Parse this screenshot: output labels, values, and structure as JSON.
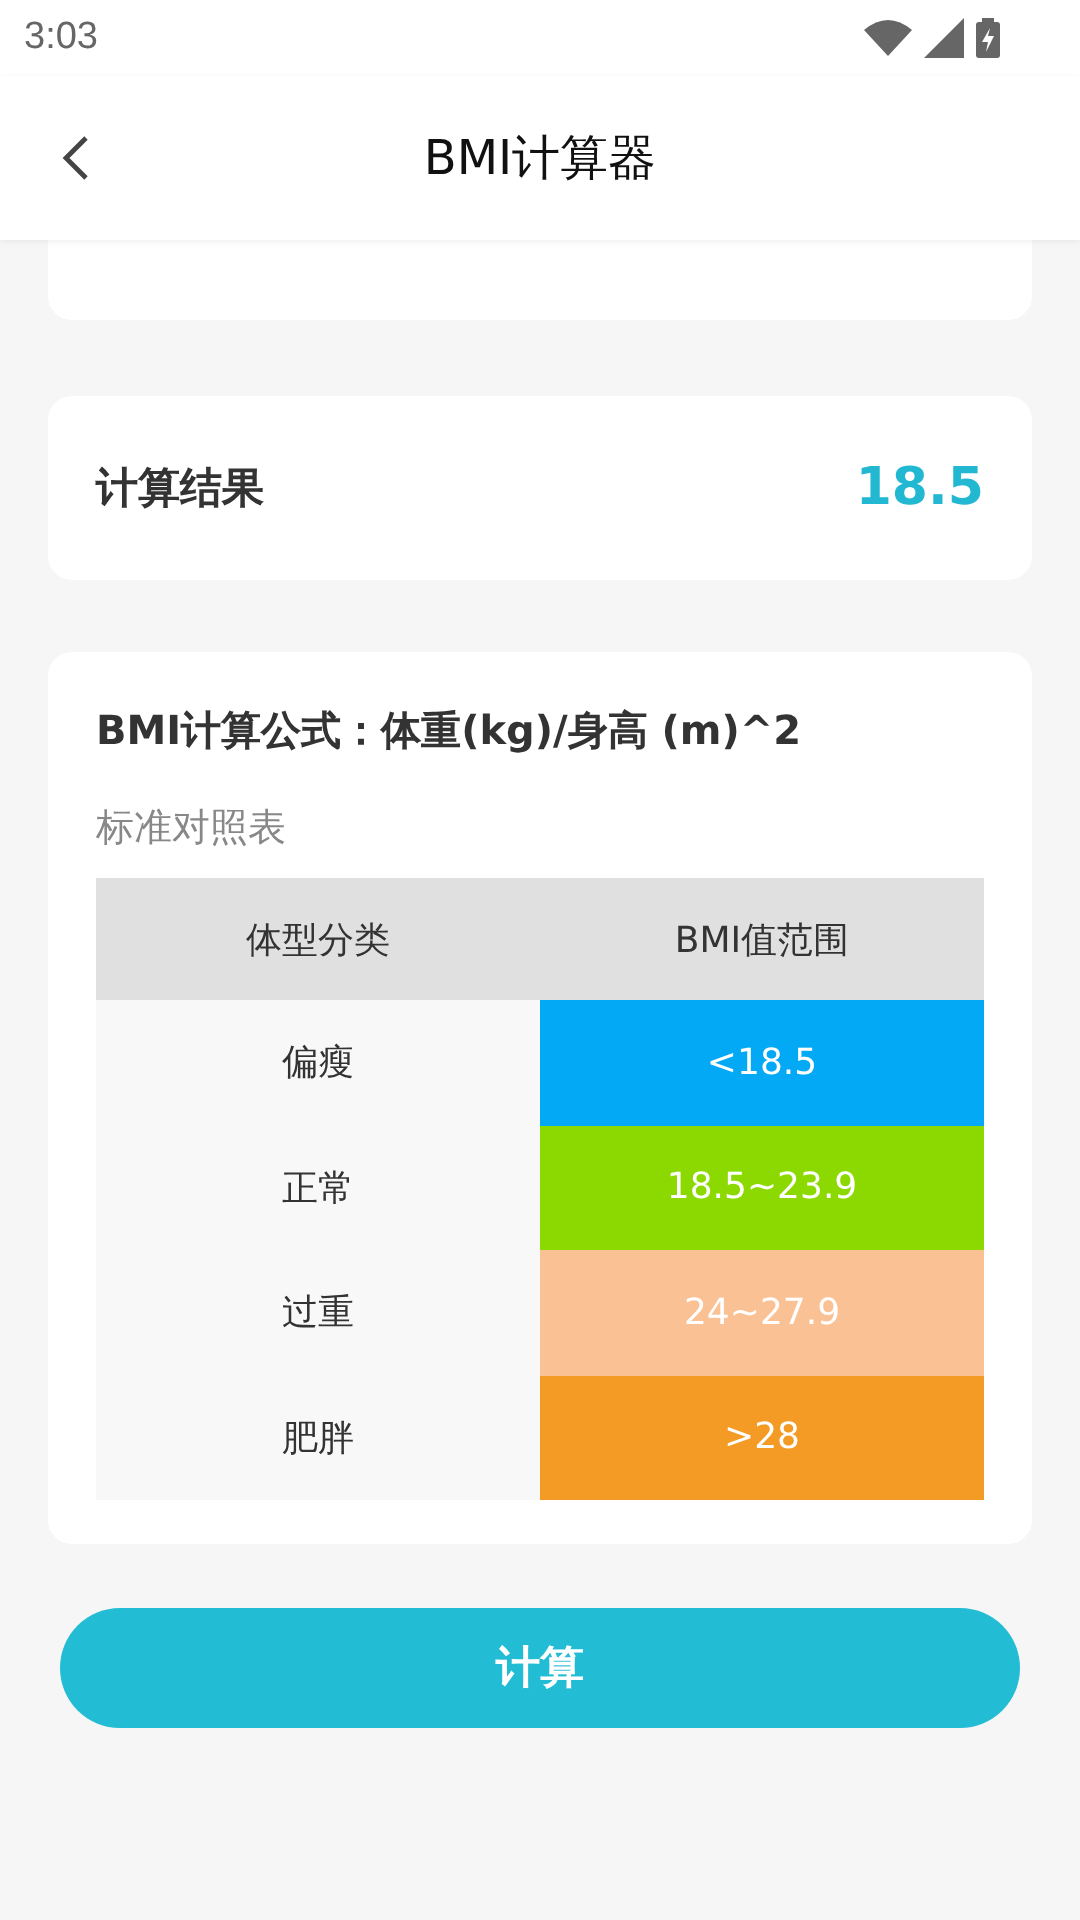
{
  "status_bar": {
    "time": "3:03"
  },
  "header": {
    "title": "BMI计算器"
  },
  "result": {
    "label": "计算结果",
    "value": "18.5"
  },
  "formula": {
    "title": "BMI计算公式：体重(kg)/身高 (m)^2",
    "subtitle": "标准对照表"
  },
  "table": {
    "columns": [
      "体型分类",
      "BMI值范围"
    ],
    "rows": [
      {
        "category": "偏瘦",
        "range": "<18.5",
        "color": "#03a9f4"
      },
      {
        "category": "正常",
        "range": "18.5~23.9",
        "color": "#8bd900"
      },
      {
        "category": "过重",
        "range": "24~27.9",
        "color": "#f9c194"
      },
      {
        "category": "肥胖",
        "range": ">28",
        "color": "#f39b25"
      }
    ]
  },
  "button": {
    "label": "计算"
  }
}
